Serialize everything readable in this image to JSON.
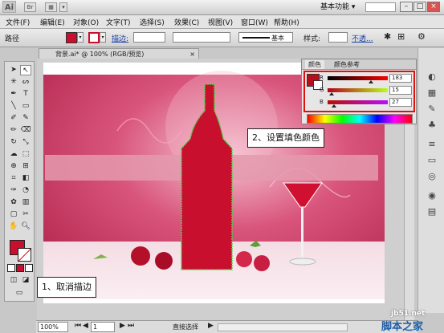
{
  "app": {
    "logo": "Ai",
    "workspace": "基本功能",
    "workspace_arrow": "▾"
  },
  "titlebar": {
    "buttons": [
      "Br",
      "▦",
      "▾"
    ]
  },
  "window_controls": {
    "minimize": "–",
    "restore": "□",
    "close": "×"
  },
  "menu": [
    "文件(F)",
    "编辑(E)",
    "对象(O)",
    "文字(T)",
    "选择(S)",
    "效果(C)",
    "视图(V)",
    "窗口(W)",
    "帮助(H)"
  ],
  "control_bar": {
    "selection_label": "路径",
    "fill_color": "#c8102e",
    "stroke_label": "描边:",
    "stroke_style": "基本",
    "style_label": "样式:",
    "opacity_label": "不透..."
  },
  "document": {
    "tab_title": "背景.ai* @ 100% (RGB/预览)",
    "close": "×"
  },
  "color_panel": {
    "tabs": [
      "颜色",
      "颜色参考"
    ],
    "channels": [
      {
        "name": "R",
        "value": "183",
        "frac": 0.72
      },
      {
        "name": "G",
        "value": "15",
        "frac": 0.06
      },
      {
        "name": "B",
        "value": "27",
        "frac": 0.11
      }
    ],
    "fill_color": "#b70f1b"
  },
  "status_bar": {
    "zoom": "100%",
    "page": "1",
    "mode": "直接选择"
  },
  "callouts": {
    "set_fill": "2、设置填色颜色",
    "cancel_stroke": "1、取消描边"
  },
  "watermark": {
    "url": "jb51.net",
    "text": "脚本之家"
  },
  "colors": {
    "accent_red": "#c8102e",
    "highlight_box": "#e01010",
    "canvas_pink": "#c43a5e"
  }
}
